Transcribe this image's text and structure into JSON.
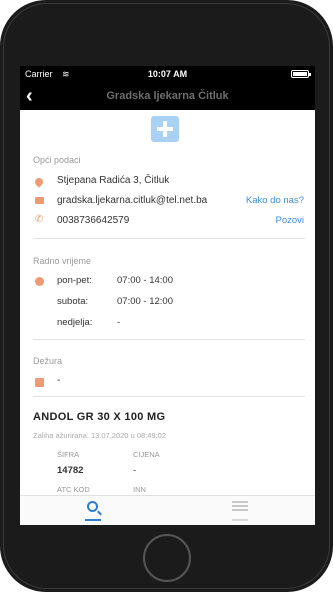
{
  "status_bar": {
    "carrier": "Carrier",
    "time": "10:07 AM"
  },
  "nav": {
    "title": "Gradska ljekarna Čitluk"
  },
  "general": {
    "label": "Opći podaci",
    "address": "Stjepana Radića 3, Čitluk",
    "email": "gradska.ljekarna.citluk@tel.net.ba",
    "directions_link": "Kako do nas?",
    "phone": "0038736642579",
    "call_link": "Pozovi"
  },
  "hours": {
    "label": "Radno vrijeme",
    "rows": [
      {
        "day": "pon-pet:",
        "time": "07:00 - 14:00"
      },
      {
        "day": "subota:",
        "time": "07:00 - 12:00"
      },
      {
        "day": "nedjelja:",
        "time": "-"
      }
    ]
  },
  "duty": {
    "label": "Dežura",
    "value": "-"
  },
  "product": {
    "name": "ANDOL  GR  30 X 100  MG",
    "updated": "Zaliha ažurirana: 13.07.2020 u 08:49:02",
    "code_label": "ŠIFRA",
    "code_value": "14782",
    "price_label": "CIJENA",
    "price_value": "-",
    "atc_label": "ATC KOD",
    "inn_label": "INN"
  },
  "tabs": {
    "search_icon": "search-icon",
    "list_icon": "list-icon"
  },
  "colors": {
    "accent": "#2f7dd1",
    "icon": "#ef9a72",
    "link": "#3d8fe0"
  }
}
